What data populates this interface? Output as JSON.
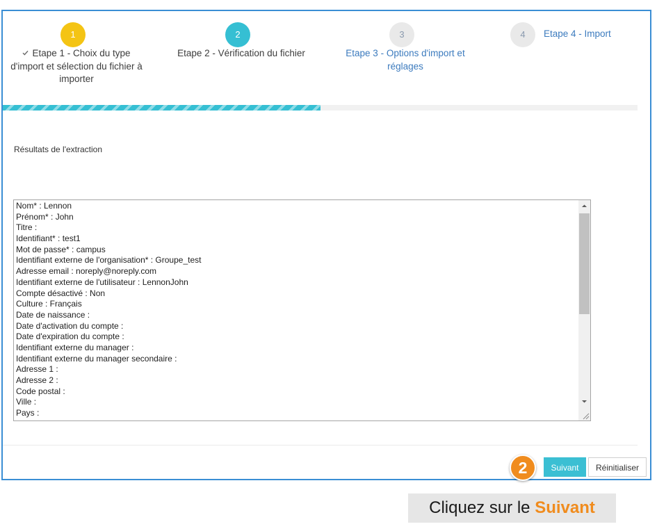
{
  "frame_border_color": "#3A8ED4",
  "wizard": {
    "steps": [
      {
        "number": "1",
        "label": "Etape 1 - Choix du type d'import et sélection du fichier à importer",
        "icon": "check-icon",
        "circle_color": "#F4C414",
        "number_color": "#FFFFFF",
        "label_color": "#3C3C3C"
      },
      {
        "number": "2",
        "label": "Etape 2 - Vérification du fichier",
        "circle_color": "#35BFD3",
        "number_color": "#FFFFFF",
        "label_color": "#3C3C3C"
      },
      {
        "number": "3",
        "label": "Etape 3 - Options d'import et réglages",
        "circle_color": "#E9E9E9",
        "number_color": "#8A9AAE",
        "label_color": "#3C7BBE"
      },
      {
        "number": "4",
        "label": "Etape 4 - Import",
        "circle_color": "#E9E9E9",
        "number_color": "#8A9AAE",
        "label_color": "#3C7BBE"
      }
    ],
    "progress_percent": 50,
    "progress_color": "#35BFD3"
  },
  "results": {
    "label": "Résultats de l'extraction",
    "lines": [
      "Nom* : Lennon",
      "Prénom* : John",
      "Titre :",
      "Identifiant* : test1",
      "Mot de passe* : campus",
      "Identifiant externe de l'organisation* : Groupe_test",
      "Adresse email : noreply@noreply.com",
      "Identifiant externe de l'utilisateur : LennonJohn",
      "Compte désactivé : Non",
      "Culture : Français",
      "Date de naissance :",
      "Date d'activation du compte :",
      "Date d'expiration du compte :",
      "Identifiant externe du manager :",
      "Identifiant externe du manager secondaire :",
      "Adresse 1 :",
      "Adresse 2 :",
      "Code postal :",
      "Ville :",
      "Pays :"
    ],
    "scroll_up_icon": "scroll-up-arrow-icon",
    "scroll_down_icon": "scroll-down-arrow-icon",
    "resize_icon": "resize-grip-icon"
  },
  "actions": {
    "next_label": "Suivant",
    "reset_label": "Réinitialiser",
    "next_color": "#3BBFD3"
  },
  "callout": {
    "badge_number": "2",
    "instruction_prefix": "Cliquez sur le ",
    "instruction_highlight": "Suivant",
    "accent_color": "#F08C1E"
  }
}
